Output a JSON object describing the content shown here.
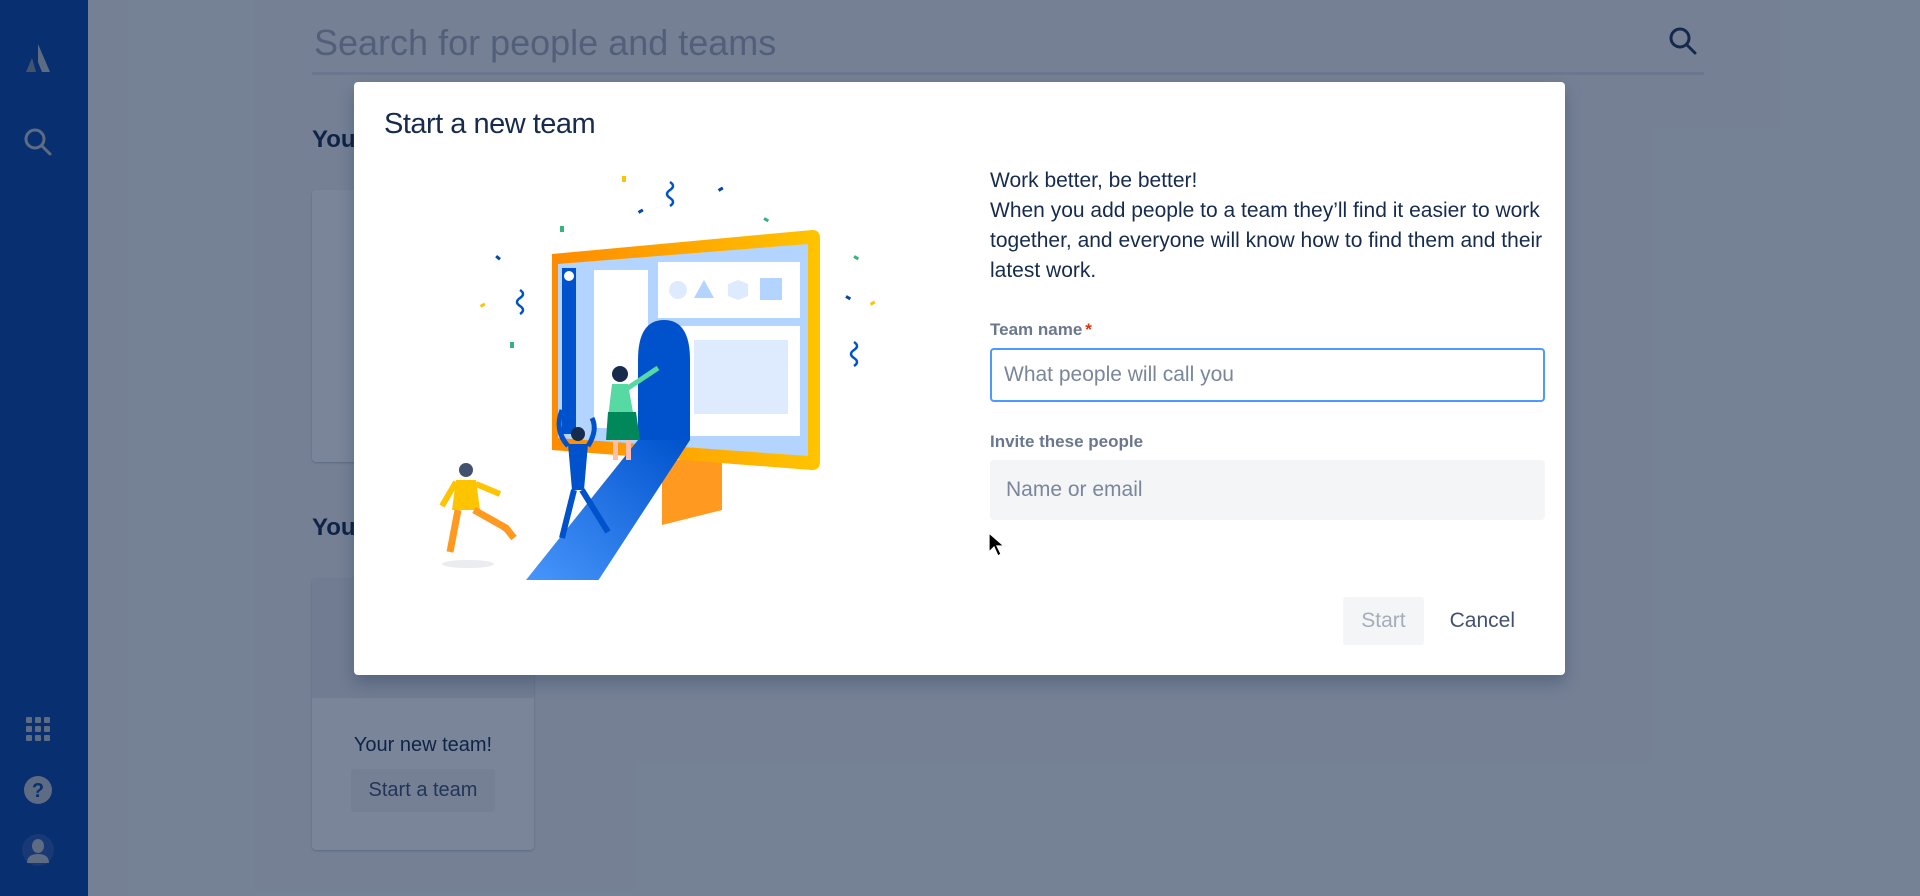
{
  "app": {
    "sidebar": {
      "top_icons": [
        "atlassian-logo-icon",
        "search-icon"
      ],
      "bottom_icons": [
        "app-switcher-icon",
        "help-icon",
        "profile-icon"
      ]
    },
    "search": {
      "placeholder": "Search for people and teams",
      "value": ""
    },
    "sections": [
      {
        "heading": "You"
      },
      {
        "heading": "You"
      }
    ],
    "new_team_card": {
      "title": "Your new team!",
      "button_label": "Start a team"
    }
  },
  "modal": {
    "title": "Start a new team",
    "intro_line1": "Work better, be better!",
    "intro_line2": "When you add people to a team they’ll find it easier to work together, and everyone will know how to find them and their latest work.",
    "team_name": {
      "label": "Team name",
      "required_marker": "*",
      "placeholder": "What people will call you",
      "value": ""
    },
    "invite": {
      "label": "Invite these people",
      "placeholder": "Name or email",
      "value": ""
    },
    "buttons": {
      "start": "Start",
      "cancel": "Cancel"
    }
  },
  "colors": {
    "sidebar": "#0747a6",
    "focus_border": "#4c9aff",
    "required": "#de350b",
    "overlay": "rgba(9,30,66,0.54)"
  }
}
